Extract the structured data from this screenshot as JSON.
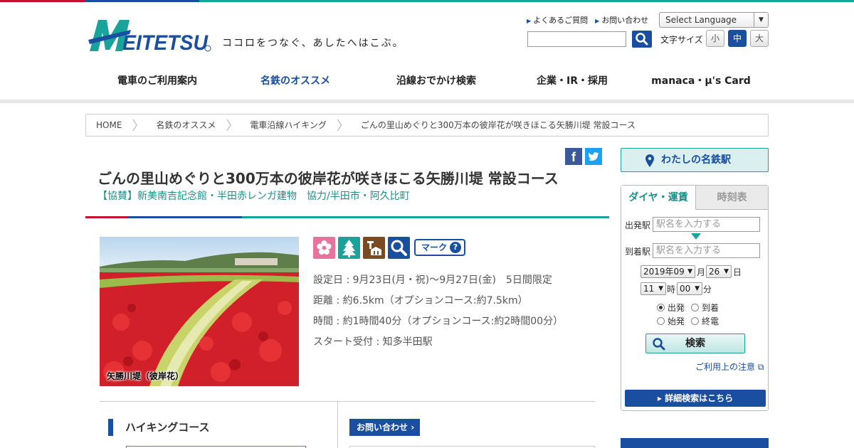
{
  "header": {
    "logo_text": "MEITETSU",
    "tagline": "ココロをつなぐ、あしたへはこぶ。",
    "top_links": [
      "よくあるご質問",
      "お問い合わせ"
    ],
    "language_select": "Select Language",
    "fontsize_label": "文字サイズ",
    "fontsize_options": [
      "小",
      "中",
      "大"
    ],
    "fontsize_active": "中"
  },
  "gnav": {
    "items": [
      "電車のご利用案内",
      "名鉄のオススメ",
      "沿線おでかけ検索",
      "企業・IR・採用",
      "manaca・μ's Card"
    ],
    "active": "名鉄のオススメ"
  },
  "breadcrumb": [
    "HOME",
    "名鉄のオススメ",
    "電車沿線ハイキング",
    "ごんの里山めぐりと300万本の彼岸花が咲きほこる矢勝川堤 常設コース"
  ],
  "article": {
    "title": "ごんの里山めぐりと300万本の彼岸花が咲きほこる矢勝川堤 常設コース",
    "sponsor": "【協賛】新美南吉記念館・半田赤レンガ建物　協力/半田市・阿久比町",
    "photo_caption": "矢勝川堤（彼岸花）",
    "mark_label": "マーク",
    "info": [
      "設定日 : 9月23日(月・祝)～9月27日(金)　5日間限定",
      "距離 : 約6.5km（オプションコース:約7.5km）",
      "時間 : 約1時間40分（オプションコース:約2時間00分）",
      "スタート受付 : 知多半田駅"
    ],
    "icon_names": [
      "flower-icon",
      "tree-icon",
      "building-icon",
      "search-icon"
    ],
    "hiking_section": "ハイキングコース",
    "contact_button": "お問い合わせ"
  },
  "sidebar": {
    "my_station": "わたしの名鉄駅",
    "tabs": [
      "ダイヤ・運賃",
      "時刻表"
    ],
    "from_label": "出発駅",
    "to_label": "到着駅",
    "from_placeholder": "駅名を入力する",
    "to_placeholder": "駅名を入力する",
    "year_month": "2019年09",
    "month_unit": "月",
    "day": "26",
    "day_unit": "日",
    "hour": "11",
    "hour_unit": "時",
    "minute": "00",
    "minute_unit": "分",
    "radios": [
      "出発",
      "到着",
      "始発",
      "終電"
    ],
    "radio_selected": "出発",
    "search_button": "検索",
    "notice_link": "ご利用上の注意",
    "detail_button": "詳細検索はこちら"
  },
  "colors": {
    "brand_blue": "#1a4fa0",
    "teal": "#1aa39a",
    "red": "#c8102e"
  }
}
